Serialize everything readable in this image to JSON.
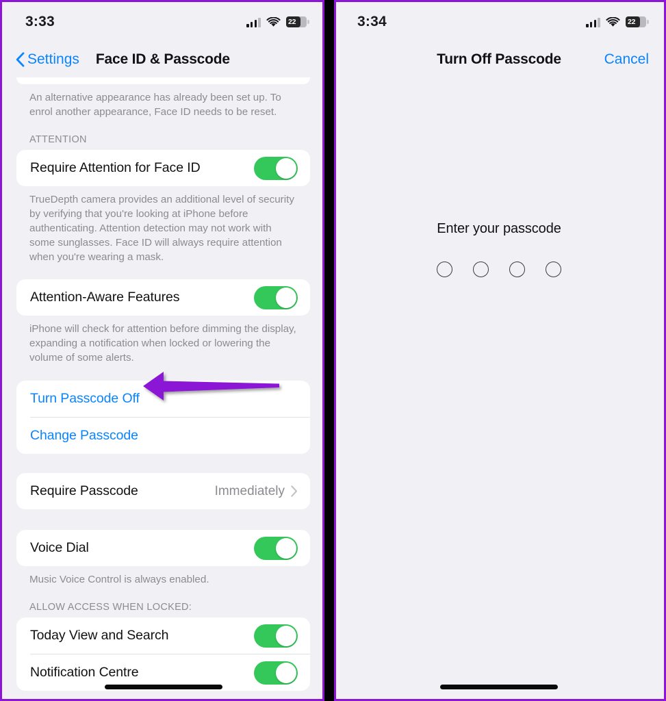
{
  "theme": {
    "accent_blue": "#0A84FF",
    "toggle_green": "#34C759",
    "annotation_purple": "#8B16D6",
    "background_grey": "#F1F1F5",
    "card_white": "#FFFFFF",
    "secondary_text": "#8B8B90"
  },
  "left_panel": {
    "status_bar": {
      "time": "3:33",
      "battery_percent": "22",
      "cellular_icon": "cellular-signal-icon",
      "wifi_icon": "wifi-icon",
      "battery_icon": "battery-icon"
    },
    "nav": {
      "back_label": "Settings",
      "back_icon": "chevron-left-icon",
      "title": "Face ID & Passcode"
    },
    "footnote_alt_appearance": "An alternative appearance has already been set up. To enrol another appearance, Face ID needs to be reset.",
    "attention_section": {
      "header": "ATTENTION",
      "row_label": "Require Attention for Face ID",
      "toggle_state": "on",
      "footnote": "TrueDepth camera provides an additional level of security by verifying that you're looking at iPhone before authenticating. Attention detection may not work with some sunglasses. Face ID will always require attention when you're wearing a mask."
    },
    "attention_aware": {
      "row_label": "Attention-Aware Features",
      "toggle_state": "on",
      "footnote": "iPhone will check for attention before dimming the display, expanding a notification when locked or lowering the volume of some alerts."
    },
    "passcode_actions": [
      {
        "label": "Turn Passcode Off",
        "style": "link"
      },
      {
        "label": "Change Passcode",
        "style": "link"
      }
    ],
    "require_passcode": {
      "label": "Require Passcode",
      "value": "Immediately",
      "chevron_icon": "chevron-right-icon"
    },
    "voice_dial": {
      "label": "Voice Dial",
      "toggle_state": "on",
      "footnote": "Music Voice Control is always enabled."
    },
    "allow_access": {
      "header": "ALLOW ACCESS WHEN LOCKED:",
      "rows": [
        {
          "label": "Today View and Search",
          "toggle_state": "on"
        },
        {
          "label": "Notification Centre",
          "toggle_state": "on"
        }
      ]
    },
    "annotation": {
      "type": "arrow-left",
      "target": "Turn Passcode Off",
      "color": "#8B16D6"
    },
    "home_indicator": "home-indicator"
  },
  "right_panel": {
    "status_bar": {
      "time": "3:34",
      "battery_percent": "22",
      "cellular_icon": "cellular-signal-icon",
      "wifi_icon": "wifi-icon",
      "battery_icon": "battery-icon"
    },
    "nav": {
      "title": "Turn Off Passcode",
      "cancel_label": "Cancel"
    },
    "passcode": {
      "prompt": "Enter your passcode",
      "field_count": 4,
      "entered_count": 0
    },
    "home_indicator": "home-indicator"
  }
}
